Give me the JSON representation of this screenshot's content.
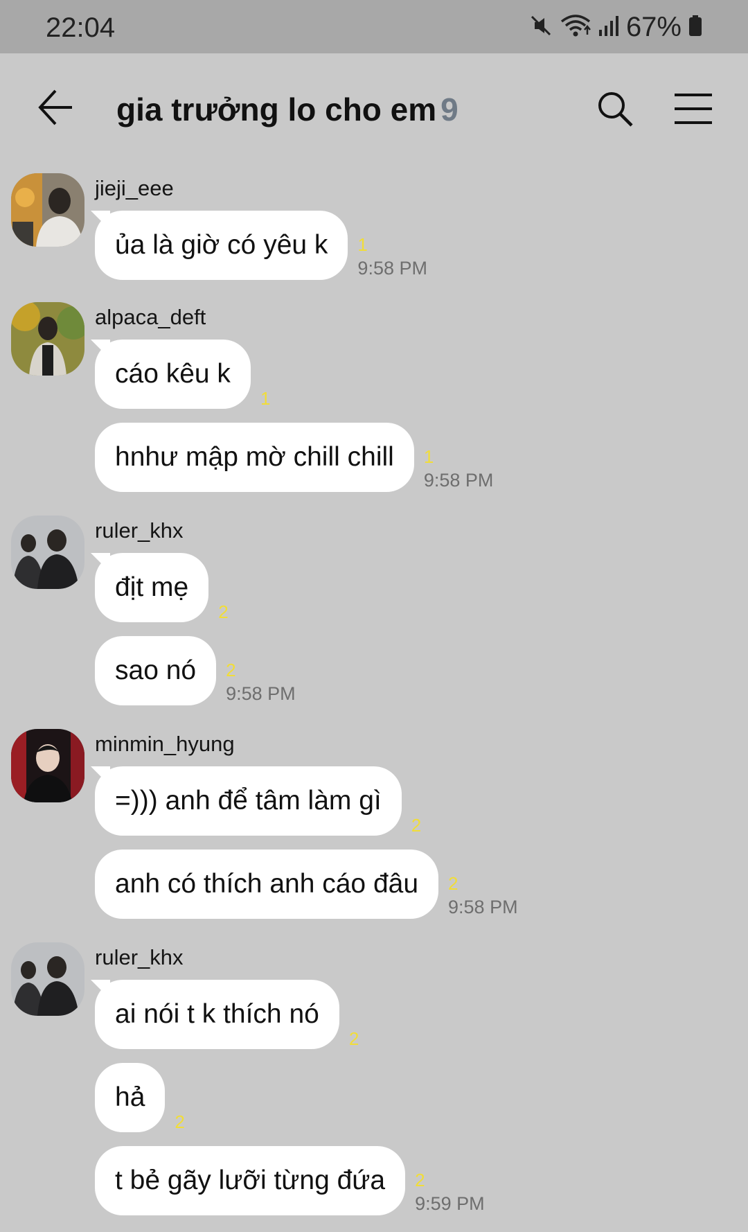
{
  "status_bar": {
    "time": "22:04",
    "battery": "67%",
    "icons": [
      "mute-icon",
      "wifi-icon",
      "signal-icon",
      "battery-icon"
    ]
  },
  "header": {
    "title": "gia trưởng lo cho em",
    "member_count": "9",
    "icons": [
      "back-arrow-icon",
      "search-icon",
      "menu-icon"
    ]
  },
  "groups": [
    {
      "sender": "jieji_eee",
      "messages": [
        {
          "text": "ủa là giờ có yêu k",
          "unread": "1",
          "time": "9:58 PM"
        }
      ]
    },
    {
      "sender": "alpaca_deft",
      "messages": [
        {
          "text": "cáo kêu k",
          "unread": "1",
          "time": ""
        },
        {
          "text": "hnhư mập mờ chill chill",
          "unread": "1",
          "time": "9:58 PM"
        }
      ]
    },
    {
      "sender": "ruler_khx",
      "messages": [
        {
          "text": "địt mẹ",
          "unread": "2",
          "time": ""
        },
        {
          "text": "sao nó",
          "unread": "2",
          "time": "9:58 PM"
        }
      ]
    },
    {
      "sender": "minmin_hyung",
      "messages": [
        {
          "text": "=))) anh để tâm làm gì",
          "unread": "2",
          "time": ""
        },
        {
          "text": "anh có thích anh cáo đâu",
          "unread": "2",
          "time": "9:58 PM"
        }
      ]
    },
    {
      "sender": "ruler_khx",
      "messages": [
        {
          "text": "ai nói t k thích nó",
          "unread": "2",
          "time": ""
        },
        {
          "text": "hả",
          "unread": "2",
          "time": ""
        },
        {
          "text": "t bẻ gãy lưỡi từng đứa",
          "unread": "2",
          "time": "9:59 PM"
        }
      ]
    }
  ],
  "colors": {
    "background": "#c9c9c9",
    "status_bar": "#a8a8a8",
    "bubble": "#ffffff",
    "unread": "#f1dd38",
    "member_count": "#6f7a86"
  }
}
